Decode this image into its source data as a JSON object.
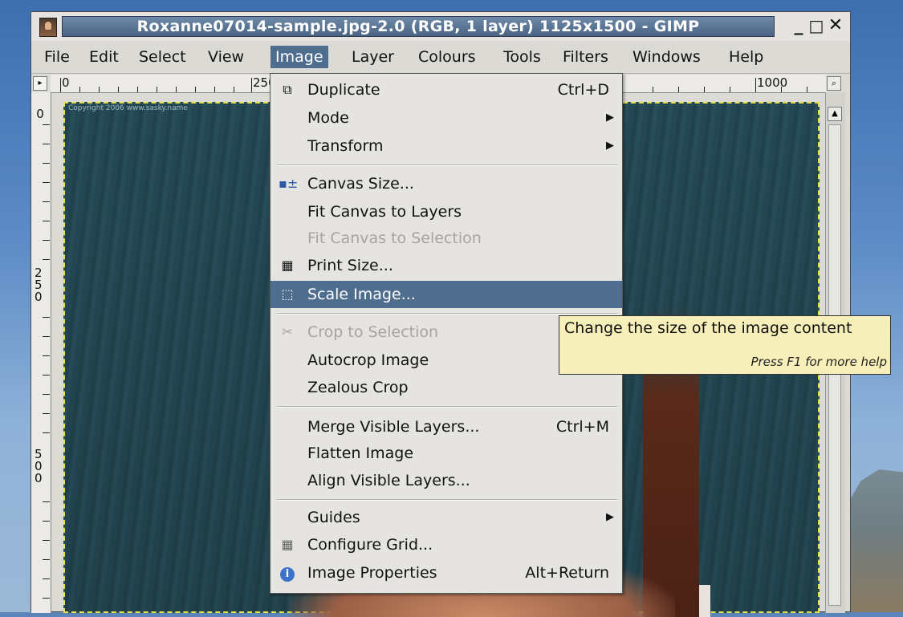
{
  "window": {
    "title": "Roxanne07014-sample.jpg-2.0 (RGB, 1 layer) 1125x1500 - GIMP",
    "controls": [
      "_",
      "□",
      "✕"
    ]
  },
  "menubar": {
    "items": [
      "File",
      "Edit",
      "Select",
      "View",
      "Image",
      "Layer",
      "Colours",
      "Tools",
      "Filters",
      "Windows",
      "Help"
    ],
    "active": "Image"
  },
  "ruler": {
    "top_labels": [
      "0",
      "250",
      "1000"
    ],
    "left_labels": [
      "0",
      "250",
      "500"
    ]
  },
  "canvas": {
    "copyright": "Copyright 2006 www.sasky.name"
  },
  "image_menu": {
    "items": [
      {
        "label": "Duplicate",
        "shortcut": "Ctrl+D",
        "icon": "duplicate-icon"
      },
      {
        "label": "Mode",
        "submenu": true
      },
      {
        "label": "Transform",
        "submenu": true
      },
      {
        "label": "Canvas Size...",
        "icon": "canvas-size-icon"
      },
      {
        "label": "Fit Canvas to Layers"
      },
      {
        "label": "Fit Canvas to Selection",
        "disabled": true
      },
      {
        "label": "Print Size...",
        "icon": "print-size-icon"
      },
      {
        "label": "Scale Image...",
        "icon": "scale-image-icon",
        "highlighted": true
      },
      {
        "label": "Crop to Selection",
        "icon": "crop-icon",
        "disabled": true
      },
      {
        "label": "Autocrop Image"
      },
      {
        "label": "Zealous Crop"
      },
      {
        "label": "Merge Visible Layers...",
        "shortcut": "Ctrl+M"
      },
      {
        "label": "Flatten Image"
      },
      {
        "label": "Align Visible Layers..."
      },
      {
        "label": "Guides",
        "submenu": true
      },
      {
        "label": "Configure Grid...",
        "icon": "grid-icon"
      },
      {
        "label": "Image Properties",
        "shortcut": "Alt+Return",
        "icon": "info-icon"
      }
    ]
  },
  "tooltip": {
    "text": "Change the size of the image content",
    "help": "Press F1 for more help"
  },
  "colors": {
    "highlight": "#4f6d8e",
    "tooltip_bg": "#f7efb9",
    "title_bg": "#5a7697"
  }
}
